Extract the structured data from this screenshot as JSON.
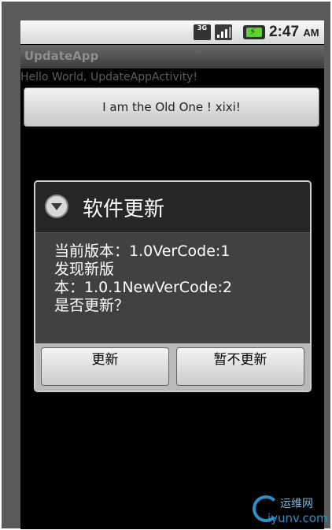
{
  "status_bar": {
    "network_label": "3G",
    "battery_glyph": "⚡",
    "time": "2:47",
    "ampm": "AM",
    "icons": [
      "3g-icon",
      "signal-icon",
      "battery-icon"
    ]
  },
  "app": {
    "title": "UpdateApp",
    "hello_text": "Hello World, UpdateAppActivity!",
    "button_label": "I am the Old One ! xixi!"
  },
  "dialog": {
    "title": "软件更新",
    "message_lines": [
      "当前版本：1.0VerCode:1",
      "发现新版",
      "本：1.0.1NewVerCode:2",
      "是否更新？"
    ],
    "buttons": {
      "update": "更新",
      "later": "暂不更新"
    }
  },
  "watermark": {
    "cn": "运维网",
    "en": "iyunv.com"
  }
}
